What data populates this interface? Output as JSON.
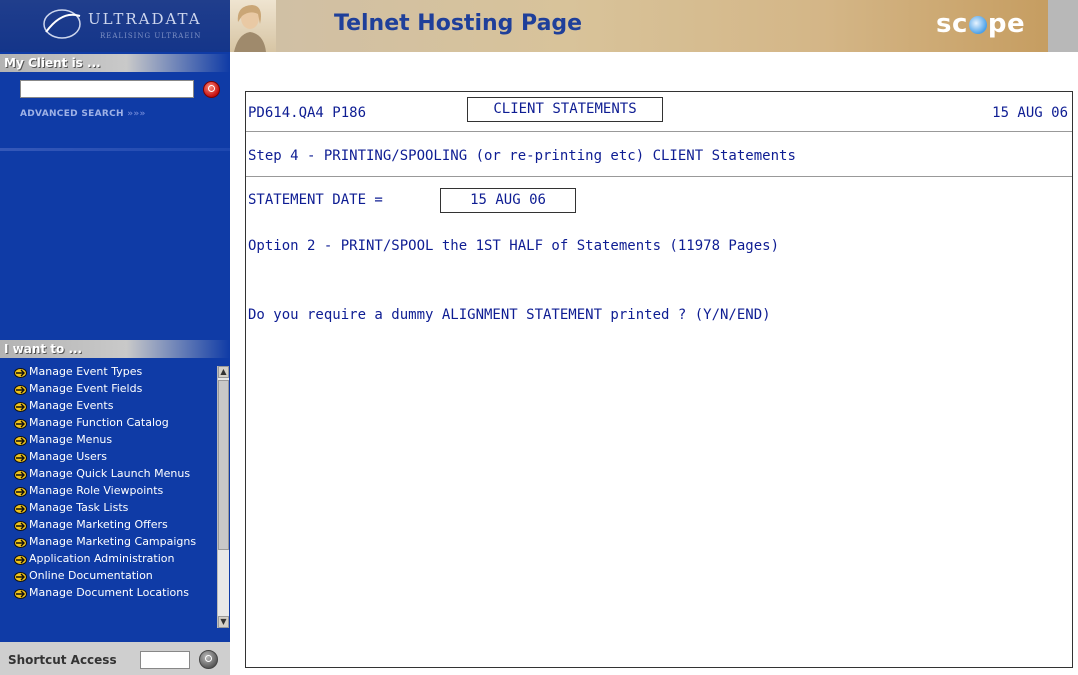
{
  "sidebar": {
    "logo": {
      "title": "ULTRADATA",
      "subtitle": "REALISING ULTRAEIN"
    },
    "client_header": "My Client is ...",
    "client_search_value": "",
    "advanced_search_label": "ADVANCED SEARCH",
    "advanced_search_arrows": "»»»",
    "want_header": "I want to ...",
    "menu_items": [
      {
        "label": "Manage Event Types"
      },
      {
        "label": "Manage Event Fields"
      },
      {
        "label": "Manage Events"
      },
      {
        "label": "Manage Function Catalog"
      },
      {
        "label": "Manage Menus"
      },
      {
        "label": "Manage Users"
      },
      {
        "label": "Manage Quick Launch Menus"
      },
      {
        "label": "Manage Role Viewpoints"
      },
      {
        "label": "Manage Task Lists"
      },
      {
        "label": "Manage Marketing Offers"
      },
      {
        "label": "Manage Marketing Campaigns"
      },
      {
        "label": "Application Administration"
      },
      {
        "label": "Online Documentation"
      },
      {
        "label": "Manage Document Locations"
      }
    ],
    "shortcut_label": "Shortcut Access",
    "shortcut_value": ""
  },
  "banner": {
    "title": "Telnet Hosting Page",
    "scope_left": "sc",
    "scope_right": "pe"
  },
  "terminal": {
    "program_id": "PD614.QA4 P186",
    "screen_title": "CLIENT STATEMENTS",
    "screen_date": "15 AUG 06",
    "step_text": "Step 4 - PRINTING/SPOOLING (or re-printing etc) CLIENT Statements",
    "statement_date_label": "STATEMENT DATE  =",
    "statement_date_value": "15 AUG 06",
    "option_text": "Option 2  -  PRINT/SPOOL the 1ST HALF of Statements    (11978 Pages)",
    "prompt_text": "Do you require a dummy ALIGNMENT STATEMENT printed ? (Y/N/END)"
  },
  "colors": {
    "sidebar_bg": "#0f3ba6",
    "terminal_text": "#0e1d93",
    "banner_title": "#1f3f9a"
  }
}
